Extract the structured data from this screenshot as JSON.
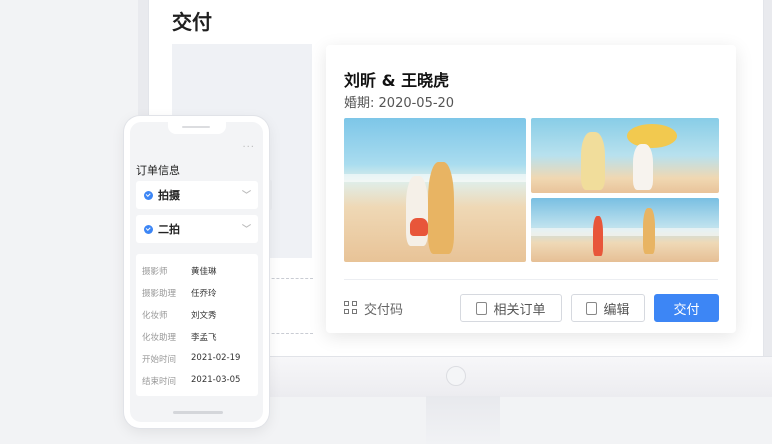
{
  "page": {
    "title": "交付"
  },
  "delivery_card": {
    "couple_names": "刘昕 & 王晓虎",
    "wedding_date_label": "婚期:",
    "wedding_date": "2020-05-20",
    "actions": {
      "delivery_code": "交付码",
      "related_orders": "相关订单",
      "edit": "编辑",
      "deliver": "交付"
    }
  },
  "phone": {
    "section_title": "订单信息",
    "sections": [
      "拍摄",
      "二拍"
    ],
    "more": "···",
    "details": [
      {
        "label": "摄影师",
        "value": "黄佳琳"
      },
      {
        "label": "摄影助理",
        "value": "任乔玲"
      },
      {
        "label": "化妆师",
        "value": "刘文秀"
      },
      {
        "label": "化妆助理",
        "value": "李孟飞"
      },
      {
        "label": "开始时间",
        "value": "2021-02-19"
      },
      {
        "label": "结束时间",
        "value": "2021-03-05"
      }
    ]
  },
  "colors": {
    "accent": "#3d86f5",
    "background": "#f2f3f5"
  }
}
